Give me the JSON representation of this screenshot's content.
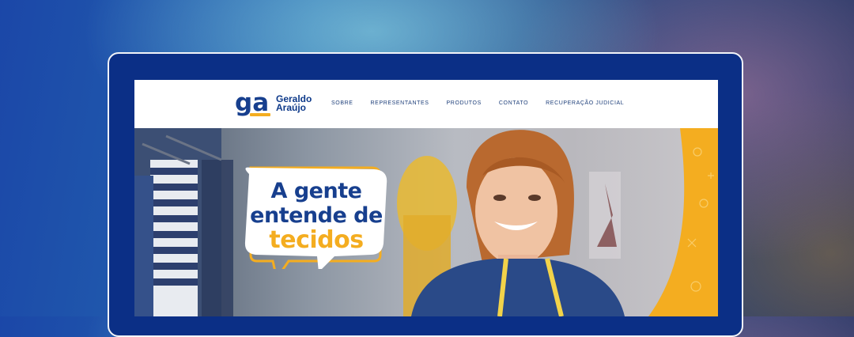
{
  "brand": {
    "mark": "ga",
    "name_line1": "Geraldo",
    "name_line2": "Araújo"
  },
  "nav": {
    "items": [
      "SOBRE",
      "REPRESENTANTES",
      "PRODUTOS",
      "CONTATO",
      "RECUPERAÇÃO JUDICIAL"
    ]
  },
  "hero": {
    "headline_line1": "A gente",
    "headline_line2": "entende de",
    "headline_line3": "tecidos"
  },
  "colors": {
    "brand_blue": "#173f8e",
    "brand_yellow": "#f4ad20",
    "frame": "#f2f4f8"
  }
}
